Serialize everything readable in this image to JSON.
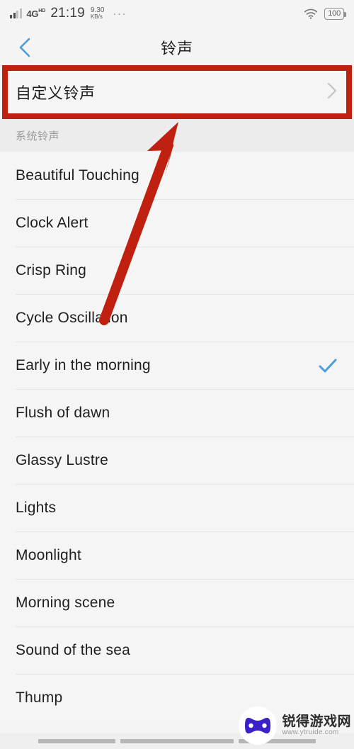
{
  "status_bar": {
    "network": "4G",
    "network_badge": "HD",
    "time": "21:19",
    "speed_value": "9.30",
    "speed_unit": "KB/s",
    "overflow": "···",
    "wifi_icon": "wifi-icon",
    "battery_level": "100"
  },
  "header": {
    "back_icon": "chevron-left-icon",
    "title": "铃声"
  },
  "custom_ringtone": {
    "label": "自定义铃声",
    "chevron_icon": "chevron-right-icon"
  },
  "section": {
    "title": "系统铃声"
  },
  "ringtones": [
    {
      "name": "Beautiful Touching",
      "selected": false
    },
    {
      "name": "Clock Alert",
      "selected": false
    },
    {
      "name": "Crisp Ring",
      "selected": false
    },
    {
      "name": "Cycle Oscillation",
      "selected": false
    },
    {
      "name": "Early in the morning",
      "selected": true
    },
    {
      "name": "Flush of dawn",
      "selected": false
    },
    {
      "name": "Glassy Lustre",
      "selected": false
    },
    {
      "name": "Lights",
      "selected": false
    },
    {
      "name": "Moonlight",
      "selected": false
    },
    {
      "name": "Morning scene",
      "selected": false
    },
    {
      "name": "Sound of the sea",
      "selected": false
    },
    {
      "name": "Thump",
      "selected": false
    }
  ],
  "annotation": {
    "highlight_color": "#c0200f",
    "arrow_color": "#c0200f",
    "arrow_icon": "arrow-up-right-icon"
  },
  "watermark": {
    "site_name": "锐得游戏网",
    "site_url": "www.ytruide.com",
    "logo_icon": "gamepad-icon",
    "logo_color": "#3a20c8"
  },
  "colors": {
    "accent_blue": "#4a9fd8",
    "checkmark": "#4a9fd8",
    "list_bg": "#f5f5f5",
    "section_bg": "#ececec"
  }
}
